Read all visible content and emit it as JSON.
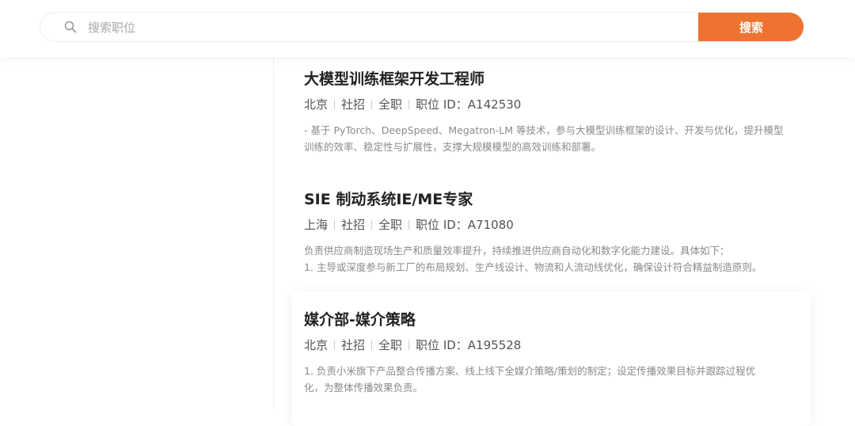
{
  "search": {
    "placeholder": "搜索职位",
    "button_label": "搜索"
  },
  "colors": {
    "accent": "#ee7331",
    "title": "#222222",
    "meta": "#555555",
    "desc": "#8a8a8a"
  },
  "jobs": [
    {
      "title": "大模型训练框架开发工程师",
      "city": "北京",
      "type": "社招",
      "employment": "全职",
      "id_label": "职位 ID：",
      "id": "A142530",
      "desc_lines": [
        "- 基于 PyTorch、DeepSpeed、Megatron-LM 等技术，参与大模型训练框架的设计、开发与优化，提升模型",
        "训练的效率、稳定性与扩展性，支撑大规模模型的高效训练和部署。"
      ]
    },
    {
      "title": "SIE 制动系统IE/ME专家",
      "city": "上海",
      "type": "社招",
      "employment": "全职",
      "id_label": "职位 ID：",
      "id": "A71080",
      "desc_lines": [
        "负责供应商制造现场生产和质量效率提升，持续推进供应商自动化和数字化能力建设。具体如下：",
        "1. 主导或深度参与新工厂的布局规划、生产线设计、物流和人流动线优化，确保设计符合精益制造原则。"
      ]
    },
    {
      "title": "媒介部-媒介策略",
      "city": "北京",
      "type": "社招",
      "employment": "全职",
      "id_label": "职位 ID：",
      "id": "A195528",
      "desc_lines": [
        "1. 负责小米旗下产品整合传播方案、线上线下全媒介策略/策划的制定；设定传播效果目标并跟踪过程优",
        "化，为整体传播效果负责。"
      ]
    }
  ]
}
